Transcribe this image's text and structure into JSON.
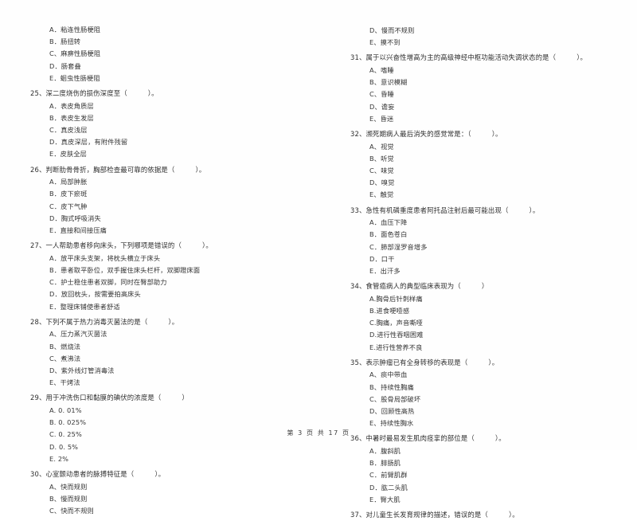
{
  "document": {
    "footer": "第 3 页 共 17 页"
  },
  "left_column": {
    "orphan_options": [
      "A．粘连性肠梗阻",
      "B．肠扭转",
      "C、麻痹性肠梗阻",
      "D．肠套叠",
      "E．蛔虫性肠梗阻"
    ],
    "questions": [
      {
        "number": "25、",
        "stem": "深二度烧伤的损伤深度至（",
        "stem_tail": "）。",
        "options": [
          "A．表皮角质层",
          "B．表皮生发层",
          "C．真皮浅层",
          "D．真皮深层，有附件残留",
          "E．皮肤全层"
        ]
      },
      {
        "number": "26、",
        "stem": "判断肋骨骨折，胸部检查最可靠的依据是（",
        "stem_tail": "）。",
        "options": [
          "A．局部肿胀",
          "B．皮下瘀斑",
          "C．皮下气肿",
          "D．胸式呼吸消失",
          "E．直接和间接压痛"
        ]
      },
      {
        "number": "27、",
        "stem": "一人帮助患者移向床头，下列哪项是错误的（",
        "stem_tail": "）。",
        "options": [
          "A．放平床头支架，将枕头横立于床头",
          "B．患者取平卧位，双手握住床头栏杆，双脚蹬床面",
          "C．护士稳住患者双脚，同时在臀部助力",
          "D．放回枕头，按需要拍高床头",
          "E．整理床铺使患者舒适"
        ]
      },
      {
        "number": "28、",
        "stem": "下列不属于热力消毒灭菌法的是（",
        "stem_tail": "）。",
        "options": [
          "A、压力蒸汽灭菌法",
          "B、燃烧法",
          "C、煮沸法",
          "D、紫外线灯管消毒法",
          "E、干烤法"
        ]
      },
      {
        "number": "29、",
        "stem": "用于冲洗伤口和黏膜的碘伏的浓度是（",
        "stem_tail": "）",
        "options": [
          "A. 0. 01%",
          "B. 0. 025%",
          "C. 0. 25%",
          "D. 0. 5%",
          "E. 2%"
        ]
      },
      {
        "number": "30、",
        "stem": "心室颤动患者的脉搏特征是（",
        "stem_tail": "）。",
        "options": [
          "A、快而规则",
          "B、慢而规则",
          "C、快而不规则"
        ]
      }
    ]
  },
  "right_column": {
    "orphan_options": [
      "D、慢而不规则",
      "E、摸不到"
    ],
    "questions": [
      {
        "number": "31、",
        "stem": "属于以兴奋性增高为主的高级神经中枢功能活动失调状态的是（",
        "stem_tail": "）。",
        "options": [
          "A、嗜睡",
          "B、意识模糊",
          "C、昏睡",
          "D、谵妄",
          "E、昏迷"
        ]
      },
      {
        "number": "32、",
        "stem": "濒死期病人最后消失的感觉常是：（",
        "stem_tail": "）。",
        "options": [
          "A、视觉",
          "B、听觉",
          "C、味觉",
          "D、嗅觉",
          "E、触觉"
        ]
      },
      {
        "number": "33、",
        "stem": "急性有机磷重度患者阿托品注射后最可能出现（",
        "stem_tail": "）。",
        "options": [
          "A．血压下降",
          "B．面色苍白",
          "C．肺部湿罗音增多",
          "D．口干",
          "E．出汗多"
        ]
      },
      {
        "number": "34、",
        "stem": "食管癌病人的典型临床表现为（",
        "stem_tail": "）",
        "options": [
          "A.胸骨后针刺样痛",
          "B.进食哽噎感",
          "C.胸痛，声音嘶哑",
          "D.进行性吞咽困难",
          "E.进行性营养不良"
        ]
      },
      {
        "number": "35、",
        "stem": "表示肿瘤已有全身转移的表现是（",
        "stem_tail": "）。",
        "options": [
          "A、痰中带血",
          "B、持续性胸痛",
          "C、股骨局部破坏",
          "D、回顾性高热",
          "E、持续性胸水"
        ]
      },
      {
        "number": "36、",
        "stem": "中暑时最易发生肌肉痉挛的部位是（",
        "stem_tail": "）。",
        "options": [
          "A．腹斜肌",
          "B．腓肠肌",
          "C．前臂肌群",
          "D．肱二头肌",
          "E．臀大肌"
        ]
      },
      {
        "number": "37、",
        "stem": "对儿童生长发育规律的描述，错误的是（",
        "stem_tail": "）。",
        "options": []
      }
    ]
  }
}
